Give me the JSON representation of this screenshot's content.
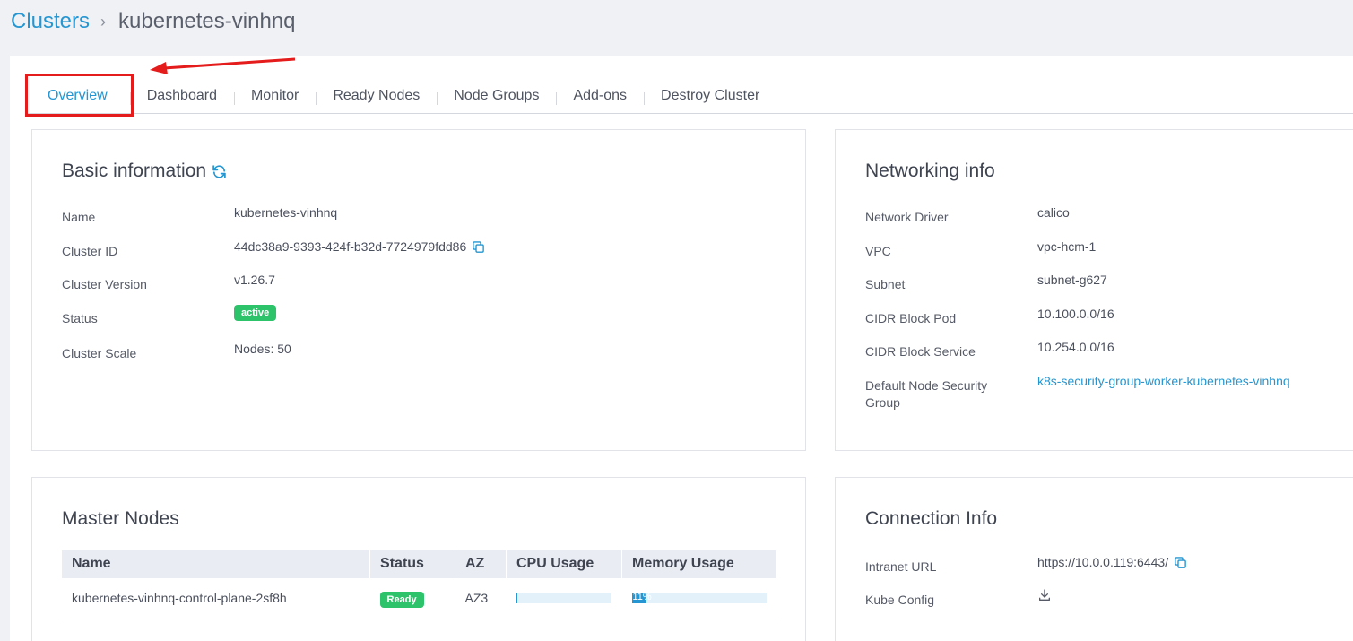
{
  "breadcrumb": {
    "parent": "Clusters",
    "separator": "›",
    "current": "kubernetes-vinhnq"
  },
  "tabs": [
    {
      "label": "Overview",
      "active": true
    },
    {
      "label": "Dashboard"
    },
    {
      "label": "Monitor"
    },
    {
      "label": "Ready Nodes"
    },
    {
      "label": "Node Groups"
    },
    {
      "label": "Add-ons"
    },
    {
      "label": "Destroy Cluster"
    }
  ],
  "basic": {
    "title": "Basic information",
    "name_label": "Name",
    "name": "kubernetes-vinhnq",
    "id_label": "Cluster ID",
    "id": "44dc38a9-9393-424f-b32d-7724979fdd86",
    "version_label": "Cluster Version",
    "version": "v1.26.7",
    "status_label": "Status",
    "status": "active",
    "scale_label": "Cluster Scale",
    "scale": "Nodes: 50"
  },
  "networking": {
    "title": "Networking info",
    "driver_label": "Network Driver",
    "driver": "calico",
    "vpc_label": "VPC",
    "vpc": "vpc-hcm-1",
    "subnet_label": "Subnet",
    "subnet": "subnet-g627",
    "pod_label": "CIDR Block Pod",
    "pod": "10.100.0.0/16",
    "service_label": "CIDR Block Service",
    "service": "10.254.0.0/16",
    "sg_label": "Default Node Security Group",
    "sg": "k8s-security-group-worker-kubernetes-vinhnq"
  },
  "master": {
    "title": "Master Nodes",
    "columns": [
      "Name",
      "Status",
      "AZ",
      "CPU Usage",
      "Memory Usage"
    ],
    "rows": [
      {
        "name": "kubernetes-vinhnq-control-plane-2sf8h",
        "status": "Ready",
        "az": "AZ3",
        "cpu": 0.01,
        "memory": 0.11,
        "memory_text": "11%"
      }
    ]
  },
  "connection": {
    "title": "Connection Info",
    "url_label": "Intranet URL",
    "url": "https://10.0.0.119:6443/",
    "kube_label": "Kube Config"
  },
  "colors": {
    "accent": "#2596d1",
    "success": "#2cc36b",
    "highlight": "#e51c1c"
  }
}
